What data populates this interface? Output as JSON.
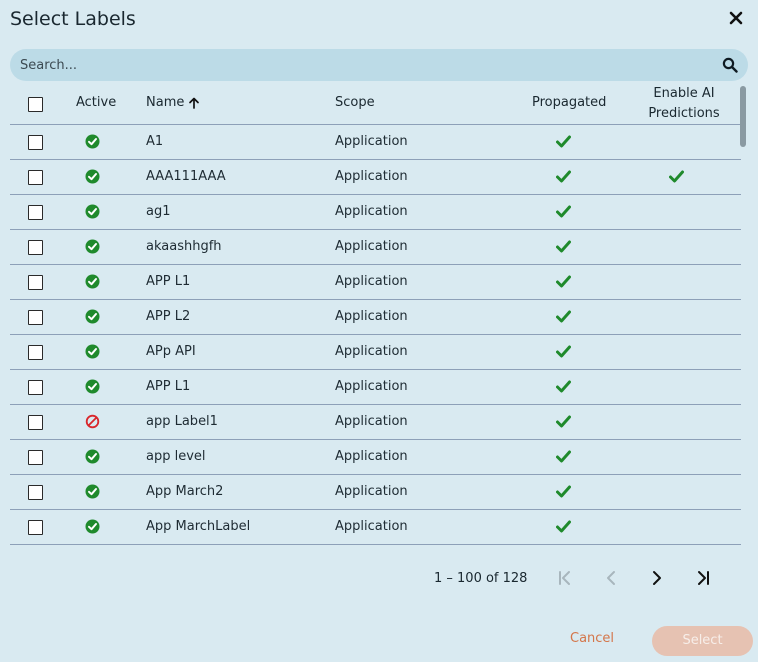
{
  "dialog": {
    "title": "Select Labels"
  },
  "search": {
    "placeholder": "Search..."
  },
  "table": {
    "columns": {
      "active": "Active",
      "name": "Name",
      "scope": "Scope",
      "propagated": "Propagated",
      "ai_line1": "Enable AI",
      "ai_line2": "Predictions"
    },
    "sort": {
      "column": "name",
      "direction": "ascending"
    },
    "rows": [
      {
        "active": true,
        "name": "A1",
        "scope": "Application",
        "propagated": true,
        "ai": false
      },
      {
        "active": true,
        "name": "AAA111AAA",
        "scope": "Application",
        "propagated": true,
        "ai": true
      },
      {
        "active": true,
        "name": "ag1",
        "scope": "Application",
        "propagated": true,
        "ai": false
      },
      {
        "active": true,
        "name": "akaashhgfh",
        "scope": "Application",
        "propagated": true,
        "ai": false
      },
      {
        "active": true,
        "name": "APP L1",
        "scope": "Application",
        "propagated": true,
        "ai": false
      },
      {
        "active": true,
        "name": "APP L2",
        "scope": "Application",
        "propagated": true,
        "ai": false
      },
      {
        "active": true,
        "name": "APp API",
        "scope": "Application",
        "propagated": true,
        "ai": false
      },
      {
        "active": true,
        "name": "APP L1",
        "scope": "Application",
        "propagated": true,
        "ai": false
      },
      {
        "active": false,
        "name": "app Label1",
        "scope": "Application",
        "propagated": true,
        "ai": false
      },
      {
        "active": true,
        "name": "app level",
        "scope": "Application",
        "propagated": true,
        "ai": false
      },
      {
        "active": true,
        "name": "App March2",
        "scope": "Application",
        "propagated": true,
        "ai": false
      },
      {
        "active": true,
        "name": "App MarchLabel",
        "scope": "Application",
        "propagated": true,
        "ai": false
      },
      {
        "active": true,
        "name": "",
        "scope": "",
        "propagated": true,
        "ai": false
      }
    ]
  },
  "pagination": {
    "range": "1 – 100 of 128"
  },
  "footer": {
    "cancel": "Cancel",
    "select": "Select"
  },
  "colors": {
    "active_green": "#1f8a2c",
    "inactive_red": "#d9262b",
    "cancel_text": "#d4764a",
    "select_bg": "#e6c2b2"
  }
}
